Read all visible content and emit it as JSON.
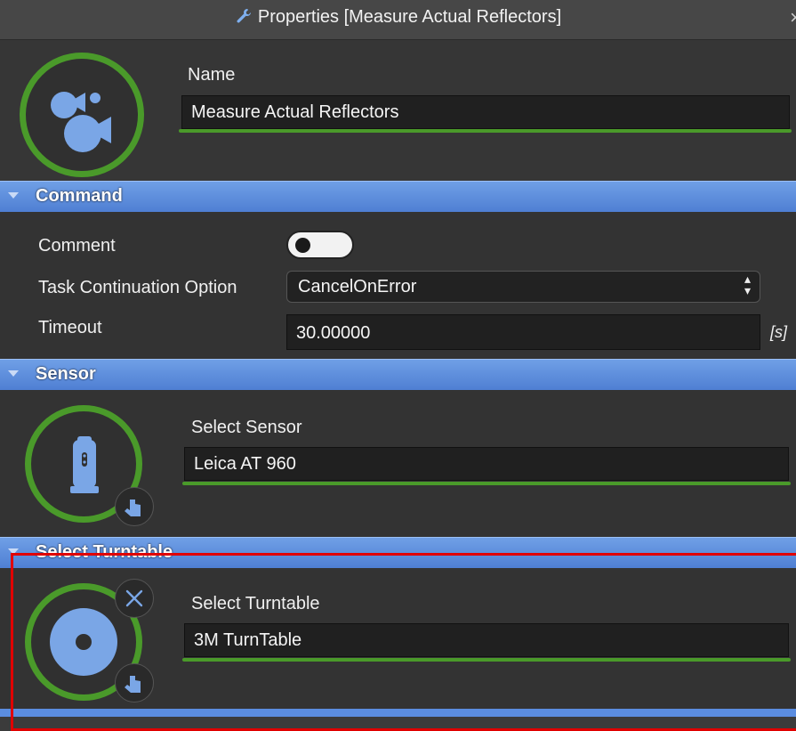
{
  "window": {
    "title": "Properties [Measure Actual Reflectors]",
    "close_glyph": "×",
    "title_icon": "wrench-icon"
  },
  "header": {
    "name_label": "Name",
    "name_value": "Measure Actual Reflectors",
    "icon": "measure-reflectors-icon"
  },
  "command": {
    "section_title": "Command",
    "comment_label": "Comment",
    "comment_toggle": false,
    "task_label": "Task Continuation Option",
    "task_value": "CancelOnError",
    "timeout_label": "Timeout",
    "timeout_value": "30.00000",
    "timeout_unit": "[s]"
  },
  "sensor": {
    "section_title": "Sensor",
    "select_label": "Select Sensor",
    "value": "Leica AT 960",
    "icon": "laser-tracker-icon"
  },
  "turntable": {
    "section_title": "Select Turntable",
    "select_label": "Select Turntable",
    "value": "3M TurnTable",
    "icon": "turntable-icon"
  },
  "colors": {
    "accent_green": "#4a9a2a",
    "section_blue": "#5b8de0",
    "highlight_red": "#e00000",
    "icon_blue": "#7aa6e6"
  }
}
